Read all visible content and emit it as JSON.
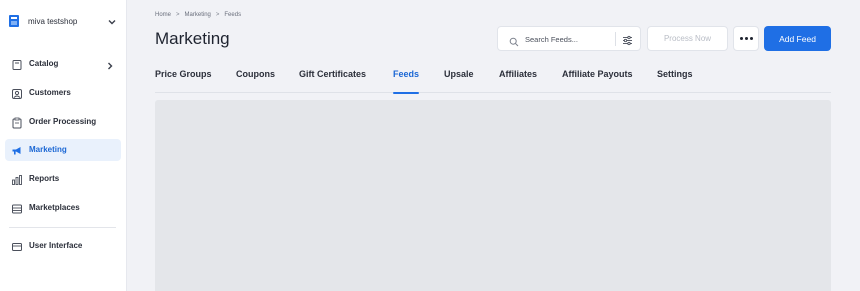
{
  "store": {
    "name": "miva testshop",
    "icon": "store-icon",
    "chevron_icon": "chevron-down-icon"
  },
  "sidebar": {
    "items": [
      {
        "label": "Catalog",
        "icon": "catalog-icon",
        "active": false,
        "has_arrow": true
      },
      {
        "label": "Customers",
        "icon": "customers-icon",
        "active": false
      },
      {
        "label": "Order Processing",
        "icon": "clipboard-icon",
        "active": false
      },
      {
        "label": "Marketing",
        "icon": "megaphone-icon",
        "active": true
      },
      {
        "label": "Reports",
        "icon": "reports-icon",
        "active": false
      },
      {
        "label": "Marketplaces",
        "icon": "marketplaces-icon",
        "active": false
      },
      {
        "label": "User Interface",
        "icon": "window-icon",
        "active": false
      }
    ]
  },
  "breadcrumb": {
    "items": [
      "Home",
      "Marketing",
      "Feeds"
    ],
    "separator": ">"
  },
  "page": {
    "title": "Marketing"
  },
  "search": {
    "placeholder": "Search Feeds..."
  },
  "toolbar": {
    "process_label": "Process Now",
    "add_label": "Add Feed"
  },
  "tabs": [
    {
      "label": "Price Groups",
      "active": false
    },
    {
      "label": "Coupons",
      "active": false
    },
    {
      "label": "Gift Certificates",
      "active": false
    },
    {
      "label": "Feeds",
      "active": true
    },
    {
      "label": "Upsale",
      "active": false
    },
    {
      "label": "Affiliates",
      "active": false
    },
    {
      "label": "Affiliate Payouts",
      "active": false
    },
    {
      "label": "Settings",
      "active": false
    }
  ],
  "colors": {
    "accent": "#1f6fe5",
    "active_bg": "#e9f1fc",
    "page_bg": "#f1f2f6"
  }
}
